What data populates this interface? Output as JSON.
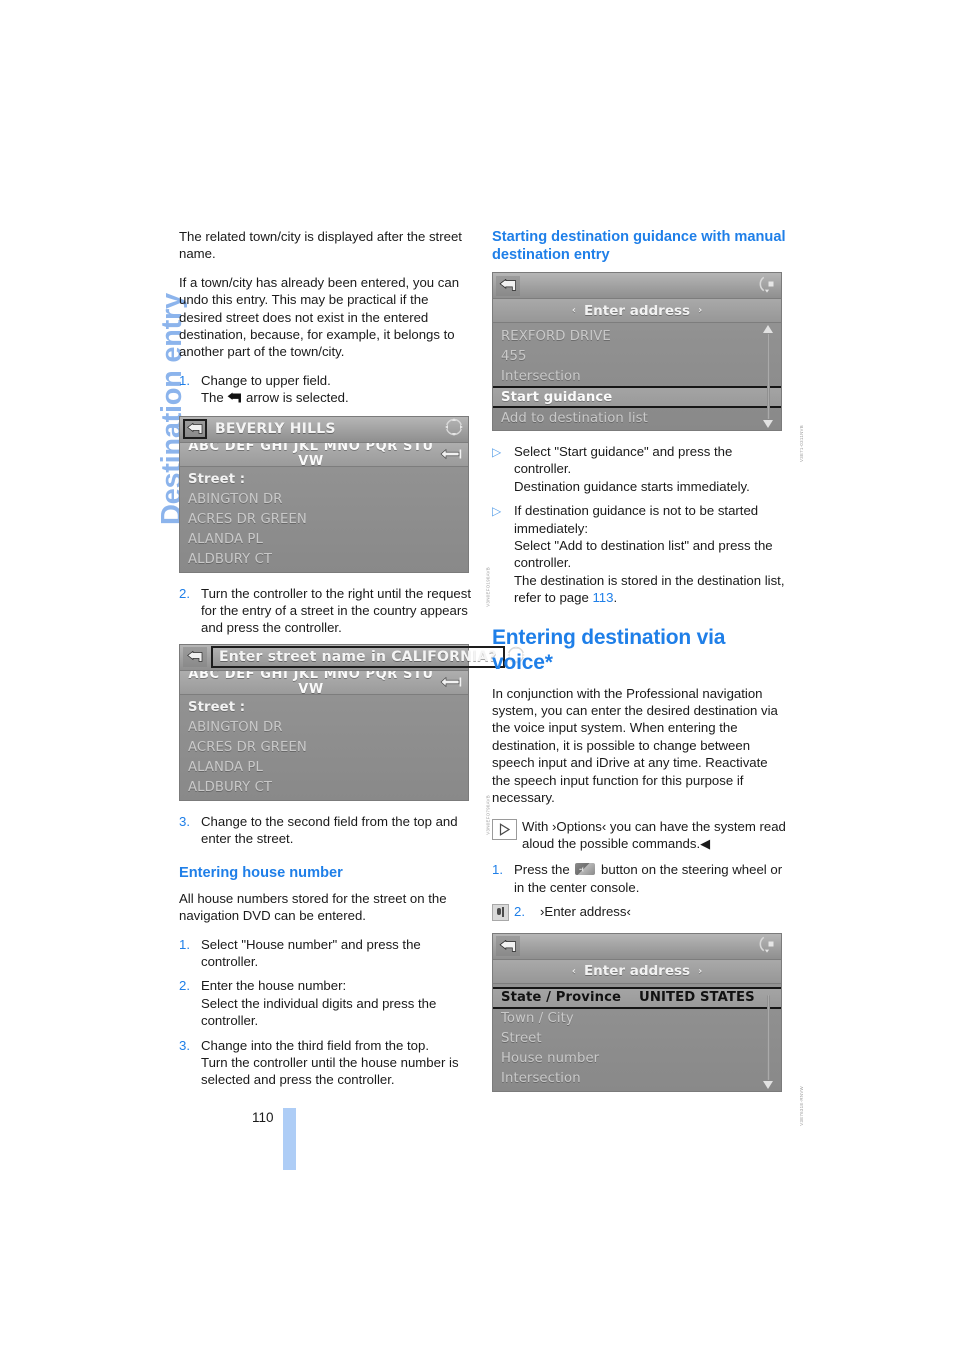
{
  "chapter": {
    "title": "Destination entry"
  },
  "folio": {
    "page_number": "110"
  },
  "left_column": {
    "intro_1": "The related town/city is displayed after the street name.",
    "intro_2": "If a town/city has already been entered, you can undo this entry. This may be practical if the desired street does not exist in the entered destination, because, for example, it belongs to another part of the town/city.",
    "step1": {
      "num": "1.",
      "line1": "Change to upper field.",
      "line2_pre": "The ",
      "line2_post": " arrow is selected."
    },
    "screenshot1": {
      "back_icon": "back-arrow-icon",
      "title": "BEVERLY HILLS",
      "controller_icon": "four-way-controller-icon",
      "letters": "ABC DEF GHI JKL MNO PQR STU VW",
      "delete_icon": "backspace-icon",
      "rows": [
        {
          "text": "Street :",
          "style": "label"
        },
        {
          "text": "ABINGTON DR",
          "style": "dim"
        },
        {
          "text": "ACRES DR GREEN",
          "style": "dim"
        },
        {
          "text": "ALANDA PL",
          "style": "dim"
        },
        {
          "text": "ALDBURY CT",
          "style": "dim"
        }
      ],
      "ref_code": "V3N0EFO190AVB"
    },
    "step2": {
      "num": "2.",
      "line1": "Turn the controller to the right until the request for the entry of a street in the country appears and press the controller."
    },
    "screenshot2": {
      "back_icon": "back-arrow-icon",
      "title": "Enter street name in CALIFORNIA?",
      "controller_icon": "four-way-controller-icon",
      "letters": "ABC DEF GHI JKL MNO PQR STU VW",
      "delete_icon": "backspace-icon",
      "rows": [
        {
          "text": "Street :",
          "style": "label"
        },
        {
          "text": "ABINGTON DR",
          "style": "dim"
        },
        {
          "text": "ACRES DR GREEN",
          "style": "dim"
        },
        {
          "text": "ALANDA PL",
          "style": "dim"
        },
        {
          "text": "ALDBURY CT",
          "style": "dim"
        }
      ],
      "ref_code": "V3N0EFO790AVB"
    },
    "step3": {
      "num": "3.",
      "line1": "Change to the second field from the top and enter the street."
    },
    "house_number_heading": "Entering house number",
    "house_number_intro": "All house numbers stored for the street on the navigation DVD can be entered.",
    "hn_step1": {
      "num": "1.",
      "line1": "Select \"House number\" and press the controller."
    },
    "hn_step2": {
      "num": "2.",
      "line1": "Enter the house number:",
      "line2": "Select the individual digits and press the controller."
    },
    "hn_step3": {
      "num": "3.",
      "line1": "Change into the third field from the top.",
      "line2": "Turn the controller until the house number is selected and press the controller."
    }
  },
  "right_column": {
    "heading_guidance": "Starting destination guidance with manual destination entry",
    "screenshot3": {
      "back_icon": "back-arrow-icon",
      "controller_icon": "rotary-controller-icon",
      "subbar_title": "Enter address",
      "arrow_left": "‹",
      "arrow_right": "›",
      "rows": [
        {
          "text": "REXFORD DRIVE",
          "style": "dim"
        },
        {
          "text": "455",
          "style": "dim"
        },
        {
          "text": "Intersection",
          "style": "dim"
        },
        {
          "text": "Start guidance",
          "style": "sel"
        },
        {
          "text": "Add to destination list",
          "style": "dim"
        }
      ],
      "ref_code": "V3E71-0311NVB"
    },
    "bullet1": {
      "marker": "▷",
      "line1": "Select \"Start guidance\" and press the controller.",
      "line2": "Destination guidance starts immediately."
    },
    "bullet2": {
      "marker": "▷",
      "line1": "If destination guidance is not to be started immediately:",
      "line2": "Select \"Add to destination list\" and press the controller.",
      "line3_pre": "The destination is stored in the destination list, refer to page ",
      "line3_ref": "113",
      "line3_post": "."
    },
    "heading_voice": "Entering destination via voice*",
    "voice_intro": "In conjunction with the Professional navigation system, you can enter the desired destination via the voice input system. When entering the destination, it is possible to change between speech input and iDrive at any time. Reactivate the speech input function for this purpose if necessary.",
    "note": {
      "icon": "play-triangle-icon",
      "line1": "With ›Options‹ you can have the system",
      "line2_pre": "read aloud the possible commands.",
      "line2_end": "◀"
    },
    "v_step1": {
      "num": "1.",
      "pre": "Press the ",
      "post": " button on the steering wheel or in the center console.",
      "button_icon": "voice-button-icon"
    },
    "v_step2": {
      "icon": "speech-input-icon",
      "num": "2.",
      "text": "›Enter address‹"
    },
    "screenshot4": {
      "back_icon": "back-arrow-icon",
      "controller_icon": "rotary-controller-icon",
      "subbar_title": "Enter address",
      "arrow_left": "‹",
      "arrow_right": "›",
      "rows": [
        {
          "text": "State / Province",
          "value": "UNITED STATES",
          "style": "sel-dark"
        },
        {
          "text": "Town / City",
          "style": "dim"
        },
        {
          "text": "Street",
          "style": "dim"
        },
        {
          "text": "House number",
          "style": "dim"
        },
        {
          "text": "Intersection",
          "style": "dim"
        }
      ],
      "ref_code": "V3E7631E-RNVW"
    }
  },
  "colors": {
    "accent_blue": "#1f7fe8",
    "tab_blue": "#8cb4ec",
    "folio_bar": "#aecdf6",
    "body_text": "#1a1a1a"
  }
}
